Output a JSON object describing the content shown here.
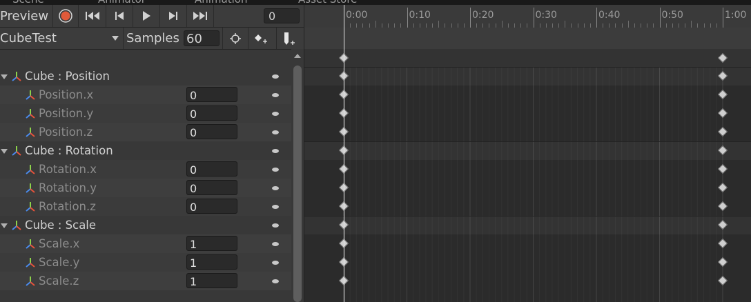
{
  "tabs": [
    "Scene",
    "Animator",
    "Animation",
    "Asset Store"
  ],
  "toolbar": {
    "preview_label": "Preview",
    "frame_value": "0"
  },
  "clip": {
    "name": "CubeTest",
    "samples_label": "Samples",
    "samples_value": "60"
  },
  "rows": [
    {
      "kind": "group",
      "label": "Cube : Position"
    },
    {
      "kind": "child",
      "label": "Position.x",
      "value": "0"
    },
    {
      "kind": "child",
      "label": "Position.y",
      "value": "0"
    },
    {
      "kind": "child",
      "label": "Position.z",
      "value": "0"
    },
    {
      "kind": "group",
      "label": "Cube : Rotation"
    },
    {
      "kind": "child",
      "label": "Rotation.x",
      "value": "0"
    },
    {
      "kind": "child",
      "label": "Rotation.y",
      "value": "0"
    },
    {
      "kind": "child",
      "label": "Rotation.z",
      "value": "0"
    },
    {
      "kind": "group",
      "label": "Cube : Scale"
    },
    {
      "kind": "child",
      "label": "Scale.x",
      "value": "1"
    },
    {
      "kind": "child",
      "label": "Scale.y",
      "value": "1"
    },
    {
      "kind": "child",
      "label": "Scale.z",
      "value": "1"
    }
  ],
  "timeline": {
    "ticks": [
      "0:00",
      "0:10",
      "0:20",
      "0:30",
      "0:40",
      "0:50",
      "1:00"
    ],
    "keyframe_times": [
      "0:00",
      "1:00"
    ]
  },
  "colors": {
    "record": "#e05a3a",
    "axis_x": "#e8533a",
    "axis_y": "#8cd24a",
    "axis_z": "#4a8cf0"
  }
}
